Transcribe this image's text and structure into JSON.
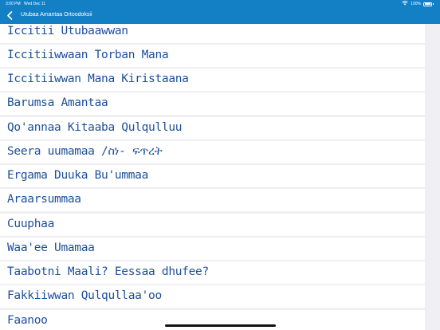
{
  "status_bar": {
    "time": "3:00 PM",
    "date": "Wed Dec 11",
    "battery": "100%",
    "wifi_icon": "wifi-icon",
    "battery_icon": "battery-icon"
  },
  "nav": {
    "back_icon": "chevron-left-icon",
    "title": "Utubaa Amantaa Ortoodoksii"
  },
  "list": {
    "items": [
      {
        "label": "Iccitii Utubaawwan"
      },
      {
        "label": "Iccitiiwwaan Torban Mana"
      },
      {
        "label": "Iccitiiwwan Mana Kiristaana"
      },
      {
        "label": "Barumsa Amantaa"
      },
      {
        "label": "Qo'annaa Kitaaba Qulqulluu"
      },
      {
        "label": "Seera uumamaa /ስነ- ፍጥረት"
      },
      {
        "label": "Ergama Duuka Bu'ummaa"
      },
      {
        "label": "Araarsummaa"
      },
      {
        "label": "Cuuphaa"
      },
      {
        "label": "Waa'ee Umamaa"
      },
      {
        "label": "Taabotni Maali? Eessaa dhufee?"
      },
      {
        "label": "Fakkiiwwan Qulqullaa'oo"
      },
      {
        "label": "Faanoo"
      }
    ]
  },
  "colors": {
    "accent": "#1380c6",
    "item_text": "#1d4f9a",
    "background": "#efeff4"
  }
}
